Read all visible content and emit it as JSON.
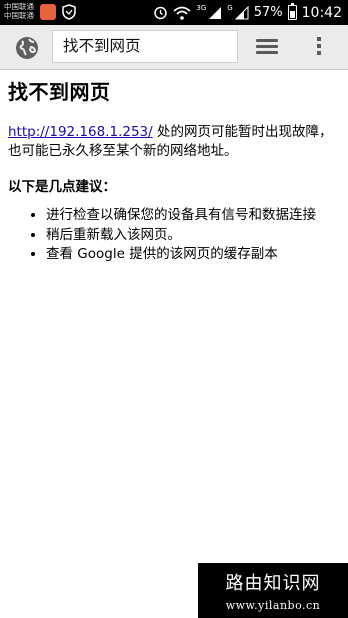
{
  "status_bar": {
    "carrier_line1": "中国联通",
    "carrier_line2": "中国联通",
    "net_3g": "3G",
    "net_g": "G",
    "battery": "57%",
    "time": "10:42"
  },
  "toolbar": {
    "url_text": "找不到网页"
  },
  "page": {
    "title": "找不到网页",
    "url": "http://192.168.1.253/",
    "message": " 处的网页可能暂时出现故障，也可能已永久移至某个新的网络地址。",
    "suggestions_heading": "以下是几点建议：",
    "suggestions": [
      "进行检查以确保您的设备具有信号和数据连接",
      "稍后重新载入该网页。",
      "查看 Google 提供的该网页的缓存副本"
    ]
  },
  "watermark": {
    "title": "路由知识网",
    "url": "www.yilanbo.cn"
  }
}
